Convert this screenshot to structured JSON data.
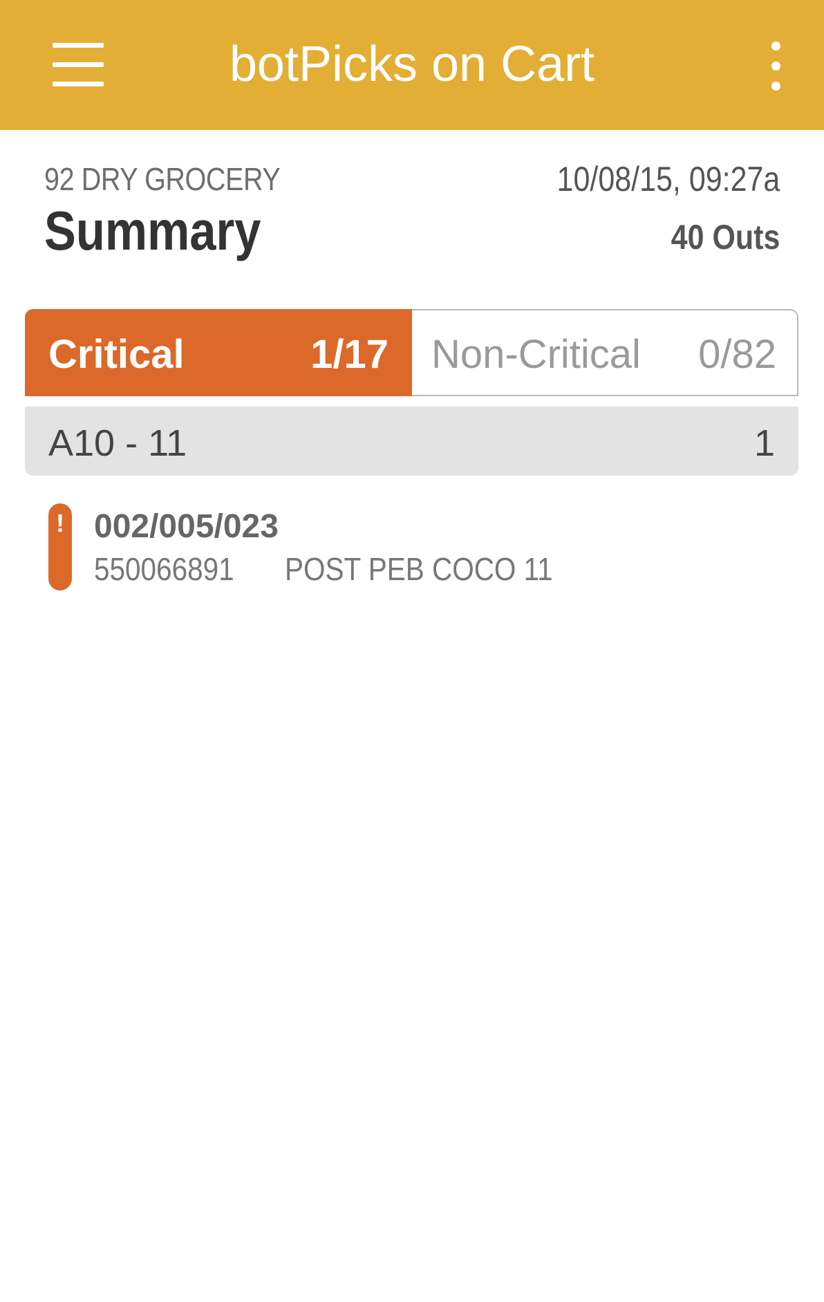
{
  "app": {
    "title": "botPicks on Cart",
    "menu_icon": "hamburger-menu-icon",
    "overflow_icon": "more-vertical-icon",
    "accent_color": "#e3ae35"
  },
  "header": {
    "section": "92 DRY GROCERY",
    "title": "Summary",
    "timestamp": "10/08/15, 09:27a",
    "outs": "40 Outs"
  },
  "tabs": [
    {
      "label": "Critical",
      "count": "1/17",
      "selected": true,
      "color": "#dc692a"
    },
    {
      "label": "Non-Critical",
      "count": "0/82",
      "selected": false
    }
  ],
  "groups": [
    {
      "name": "A10 - 11",
      "count": "1",
      "items": [
        {
          "alert": "!",
          "location": "002/005/023",
          "upc": "550066891",
          "description": "POST PEB COCO 11",
          "status_color": "#dc692a"
        }
      ]
    }
  ]
}
